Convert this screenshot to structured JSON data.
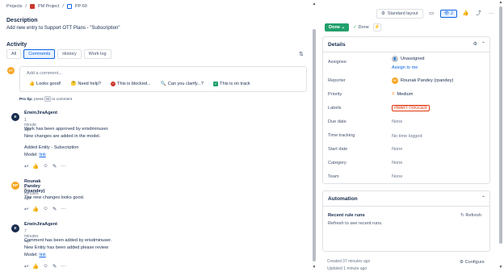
{
  "breadcrumb": {
    "root": "Projects",
    "project": "PM Project",
    "issue": "PP-60"
  },
  "description": {
    "title": "Description",
    "text": "Add new entry to Support OTT Plans - \"Subscription\""
  },
  "activity": {
    "title": "Activity",
    "tabs": [
      "All",
      "Comments",
      "History",
      "Work log"
    ],
    "active_tab": "Comments"
  },
  "comment_box": {
    "avatar": "RP",
    "placeholder": "Add a comment...",
    "quick_replies": [
      "Looks good!",
      "Need help?",
      "This is blocked...",
      "Can you clarify...?",
      "This is on track"
    ],
    "protip_label": "Pro tip:",
    "protip_press": "press",
    "protip_key": "M",
    "protip_suffix": "to comment"
  },
  "comments": [
    {
      "avatar": "E",
      "author": "ErwinJiraAgent",
      "time": "1 minute ago",
      "lines": [
        "Work has been approved by erisdminuser.",
        "New changes are added in the model.",
        "",
        "Added Entity - Subscription"
      ],
      "model_label": "Model:",
      "link": "link"
    },
    {
      "avatar": "RP",
      "author": "Rounak Pandey (rpandey)",
      "time": "5 minutes ago",
      "lines": [
        "The new changes looks good."
      ]
    },
    {
      "avatar": "E",
      "author": "ErwinJiraAgent",
      "time": "7 minutes ago",
      "lines": [
        "Comment has been added by erisdminuser.",
        "New Entity has been added please review"
      ],
      "model_label": "Model:",
      "link": "link"
    }
  ],
  "toolbar": {
    "layout_label": "Standard layout",
    "watch_count": "2"
  },
  "status": {
    "done_label": "Done",
    "resolution": "Done"
  },
  "details": {
    "title": "Details",
    "fields": {
      "assignee_label": "Assignee",
      "assignee_value": "Unassigned",
      "assign_to_me": "Assign to me",
      "reporter_label": "Reporter",
      "reporter_avatar": "RP",
      "reporter_value": "Rounak Pandey (rpandey)",
      "priority_label": "Priority",
      "priority_value": "Medium",
      "labels_label": "Labels",
      "labels_value": "#MART-TRIGGER",
      "due_label": "Due date",
      "due_value": "None",
      "tracking_label": "Time tracking",
      "tracking_value": "No time logged",
      "start_label": "Start date",
      "start_value": "None",
      "category_label": "Category",
      "category_value": "None",
      "team_label": "Team",
      "team_value": "None"
    }
  },
  "automation": {
    "title": "Automation",
    "rule_title": "Recent rule runs",
    "rule_subtitle": "Refresh to see recent runs.",
    "refresh_label": "Refresh"
  },
  "footer": {
    "created": "Created 37 minutes ago",
    "updated": "Updated 1 minute ago",
    "configure": "Configure"
  },
  "colors": {
    "accent": "#0c66e4",
    "done": "#22a06b",
    "label": "#de350b",
    "rp_avatar": "#f5a623"
  }
}
